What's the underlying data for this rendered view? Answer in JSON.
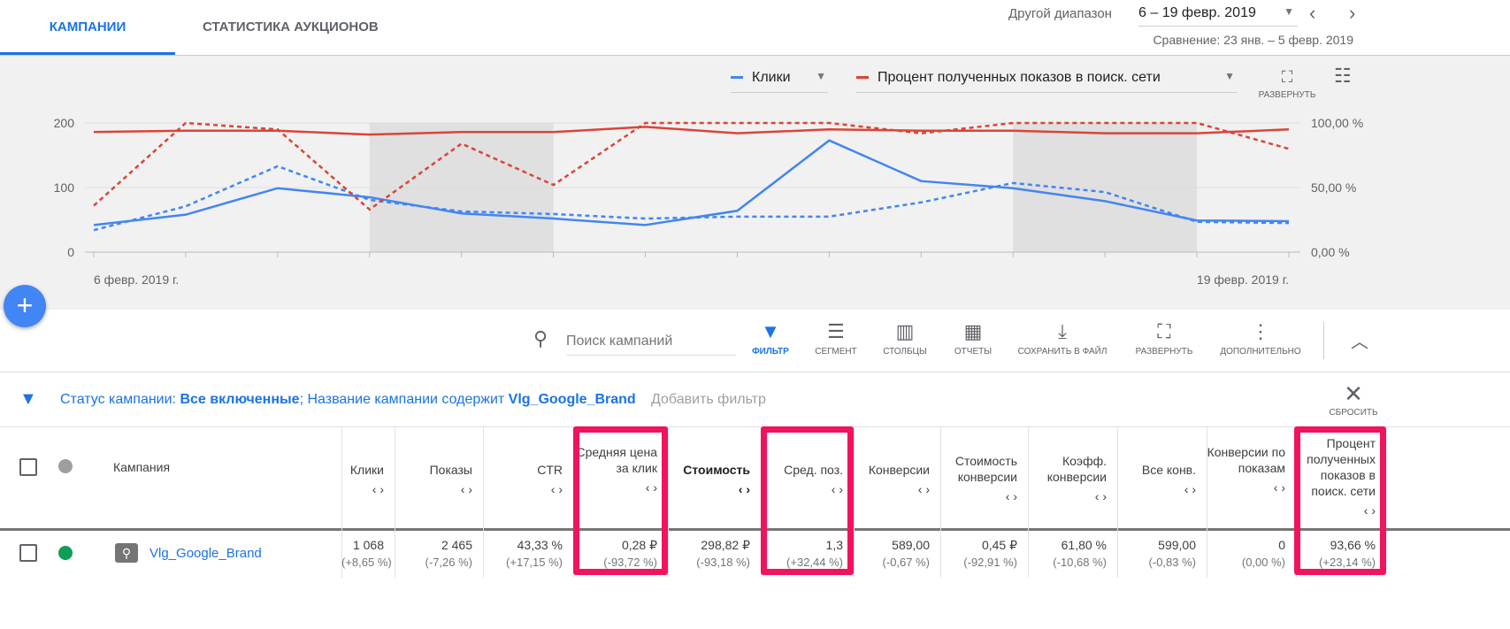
{
  "tabs": [
    "КАМПАНИИ",
    "СТАТИСТИКА АУКЦИОНОВ"
  ],
  "date": {
    "range_label": "Другой диапазон",
    "range": "6 – 19 февр. 2019",
    "comparison": "Сравнение: 23 янв. – 5 февр. 2019"
  },
  "chart_controls": {
    "metric1": "Клики",
    "metric2": "Процент полученных показов в поиск. сети",
    "expand": "РАЗВЕРНУТЬ"
  },
  "colors": {
    "blue": "#4285f4",
    "red": "#db4437",
    "accent": "#1a73e8",
    "highlight": "#f0135f"
  },
  "chart_data": {
    "type": "line",
    "x": [
      "6 февр.",
      "7 февр.",
      "8 февр.",
      "9 февр.",
      "10 февр.",
      "11 февр.",
      "12 февр.",
      "13 февр.",
      "14 февр.",
      "15 февр.",
      "16 февр.",
      "17 февр.",
      "18 февр.",
      "19 февр."
    ],
    "x_tick_labels": [
      "6 февр. 2019 г.",
      "19 февр. 2019 г."
    ],
    "y_left": {
      "ticks": [
        "0",
        "100",
        "200"
      ],
      "range": [
        0,
        200
      ]
    },
    "y_right": {
      "ticks": [
        "0,00 %",
        "50,00 %",
        "100,00 %"
      ],
      "range": [
        0,
        100
      ]
    },
    "series": [
      {
        "name": "Клики",
        "axis": "left",
        "style": "solid",
        "color": "#4285f4",
        "values": [
          42,
          58,
          99,
          85,
          60,
          52,
          42,
          64,
          173,
          110,
          99,
          79,
          49,
          48
        ]
      },
      {
        "name": "Клики (сравнение)",
        "axis": "left",
        "style": "dashed",
        "color": "#4285f4",
        "values": [
          34,
          71,
          133,
          81,
          63,
          59,
          52,
          55,
          55,
          77,
          107,
          93,
          47,
          45
        ]
      },
      {
        "name": "Процент полученных показов в поиск. сети",
        "axis": "right",
        "style": "solid",
        "color": "#db4437",
        "values": [
          93,
          94,
          94,
          91,
          93,
          93,
          97,
          92,
          95,
          94,
          94,
          92,
          92,
          95
        ]
      },
      {
        "name": "Процент полученных показов в поиск. сети (сравнение)",
        "axis": "right",
        "style": "dashed",
        "color": "#db4437",
        "values": [
          36,
          100,
          95,
          33,
          84,
          52,
          100,
          100,
          100,
          92,
          100,
          100,
          100,
          80
        ]
      }
    ],
    "shaded_weekends": [
      [
        3,
        4
      ],
      [
        10,
        11
      ]
    ]
  },
  "toolbar": {
    "search_placeholder": "Поиск кампаний",
    "items": [
      "ФИЛЬТР",
      "СЕГМЕНТ",
      "СТОЛБЦЫ",
      "ОТЧЕТЫ",
      "СОХРАНИТЬ В ФАЙЛ",
      "РАЗВЕРНУТЬ",
      "ДОПОЛНИТЕЛЬНО"
    ]
  },
  "filter": {
    "status_label": "Статус кампании: ",
    "status_value": "Все включенные",
    "sep": "; Название кампании содержит ",
    "name_value": "Vlg_Google_Brand",
    "add": "Добавить фильтр",
    "reset": "СБРОСИТЬ"
  },
  "table": {
    "campaign_header": "Кампания",
    "columns": [
      "Клики",
      "Показы",
      "CTR",
      "Средняя цена за клик",
      "Стоимость",
      "Сред. поз.",
      "Конверсии",
      "Стоимость конверсии",
      "Коэфф. конверсии",
      "Все конв.",
      "Конверсии по показам",
      "Процент полученных показов в поиск. сети"
    ],
    "row": {
      "name": "Vlg_Google_Brand",
      "values": [
        "1 068",
        "2 465",
        "43,33 %",
        "0,28 ₽",
        "298,82 ₽",
        "1,3",
        "589,00",
        "0,45 ₽",
        "61,80 %",
        "599,00",
        "0",
        "93,66 %"
      ],
      "changes": [
        "(+8,65 %)",
        "(-7,26 %)",
        "(+17,15 %)",
        "(-93,72 %)",
        "(-93,18 %)",
        "(+32,44 %)",
        "(-0,67 %)",
        "(-92,91 %)",
        "(-10,68 %)",
        "(-0,83 %)",
        "(0,00 %)",
        "(+23,14 %)"
      ]
    }
  }
}
